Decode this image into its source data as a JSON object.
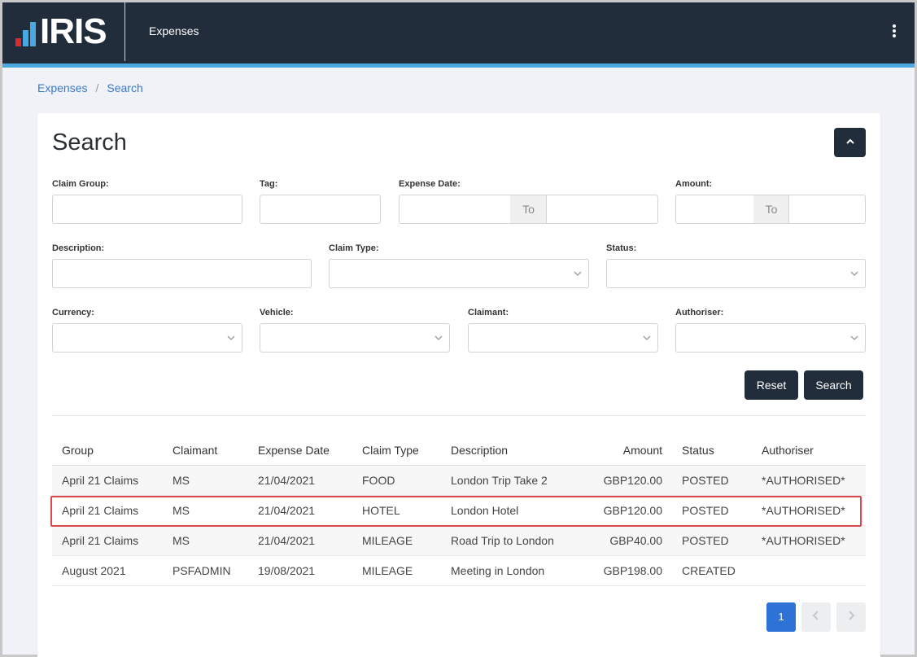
{
  "header": {
    "logo_text": "IRIS",
    "logo_bar_colors": [
      "#d62e2e",
      "#4aa8e0",
      "#4aa8e0"
    ],
    "app_title": "Expenses",
    "menu_icon": "vertical-dots-icon"
  },
  "breadcrumb": {
    "items": [
      "Expenses",
      "Search"
    ],
    "separator": "/"
  },
  "search_card": {
    "title": "Search",
    "collapse_icon": "chevron-up-icon",
    "fields": {
      "claim_group": {
        "label": "Claim Group:",
        "value": ""
      },
      "tag": {
        "label": "Tag:",
        "value": ""
      },
      "expense_date": {
        "label": "Expense Date:",
        "from": "",
        "to_label": "To",
        "to": ""
      },
      "amount": {
        "label": "Amount:",
        "from": "",
        "to_label": "To",
        "to": ""
      },
      "description": {
        "label": "Description:",
        "value": ""
      },
      "claim_type": {
        "label": "Claim Type:",
        "value": ""
      },
      "status": {
        "label": "Status:",
        "value": ""
      },
      "currency": {
        "label": "Currency:",
        "value": ""
      },
      "vehicle": {
        "label": "Vehicle:",
        "value": ""
      },
      "claimant": {
        "label": "Claimant:",
        "value": ""
      },
      "authoriser": {
        "label": "Authoriser:",
        "value": ""
      }
    },
    "buttons": {
      "reset": "Reset",
      "search": "Search"
    }
  },
  "results": {
    "columns": [
      "Group",
      "Claimant",
      "Expense Date",
      "Claim Type",
      "Description",
      "Amount",
      "Status",
      "Authoriser"
    ],
    "rows": [
      [
        "April 21 Claims",
        "MS",
        "21/04/2021",
        "FOOD",
        "London Trip Take 2",
        "GBP120.00",
        "POSTED",
        "*AUTHORISED*"
      ],
      [
        "April 21 Claims",
        "MS",
        "21/04/2021",
        "HOTEL",
        "London Hotel",
        "GBP120.00",
        "POSTED",
        "*AUTHORISED*"
      ],
      [
        "April 21 Claims",
        "MS",
        "21/04/2021",
        "MILEAGE",
        "Road Trip to London",
        "GBP40.00",
        "POSTED",
        "*AUTHORISED*"
      ],
      [
        "August 2021",
        "PSFADMIN",
        "19/08/2021",
        "MILEAGE",
        "Meeting in London",
        "GBP198.00",
        "CREATED",
        ""
      ]
    ],
    "highlighted_row": 1,
    "highlight_color": "#e0474c"
  },
  "pagination": {
    "current_page": "1",
    "prev_icon": "chevron-left-icon",
    "next_icon": "chevron-right-icon",
    "active_color": "#2f72d6"
  }
}
